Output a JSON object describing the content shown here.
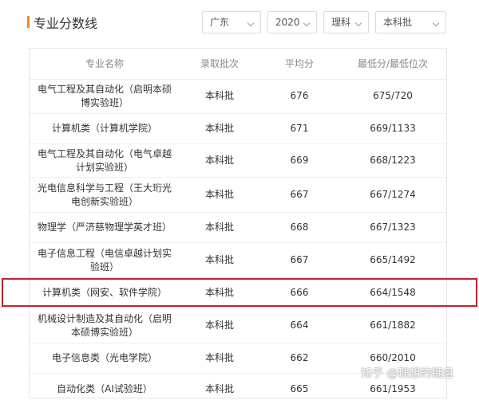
{
  "header": {
    "title": "专业分数线",
    "filters": {
      "province": "广东",
      "year": "2020",
      "subject": "理科",
      "batch": "本科批"
    }
  },
  "table": {
    "columns": [
      "专业名称",
      "录取批次",
      "平均分",
      "最低分/最低位次"
    ],
    "rows": [
      {
        "major": "电气工程及其自动化（启明本硕博实验班）",
        "batch": "本科批",
        "avg": "676",
        "min": "675/720"
      },
      {
        "major": "计算机类（计算机学院）",
        "batch": "本科批",
        "avg": "671",
        "min": "669/1133"
      },
      {
        "major": "电气工程及其自动化（电气卓越计划实验班）",
        "batch": "本科批",
        "avg": "669",
        "min": "668/1223"
      },
      {
        "major": "光电信息科学与工程（王大珩光电创新实验班）",
        "batch": "本科批",
        "avg": "667",
        "min": "667/1274"
      },
      {
        "major": "物理学（严济慈物理学英才班）",
        "batch": "本科批",
        "avg": "668",
        "min": "667/1323"
      },
      {
        "major": "电子信息工程（电信卓越计划实验班）",
        "batch": "本科批",
        "avg": "667",
        "min": "665/1492"
      },
      {
        "major": "计算机类（网安、软件学院）",
        "batch": "本科批",
        "avg": "666",
        "min": "664/1548"
      },
      {
        "major": "机械设计制造及其自动化（启明本硕博实验班）",
        "batch": "本科批",
        "avg": "664",
        "min": "661/1882"
      },
      {
        "major": "电子信息类（光电学院）",
        "batch": "本科批",
        "avg": "662",
        "min": "660/2010"
      },
      {
        "major": "自动化类（AI试验班）",
        "batch": "本科批",
        "avg": "665",
        "min": "661/1953"
      }
    ]
  },
  "watermark": "知乎 @理想的键盘",
  "colors": {
    "accent": "#f28a1e",
    "highlight_border": "#c8202a",
    "header_text": "#888888"
  }
}
